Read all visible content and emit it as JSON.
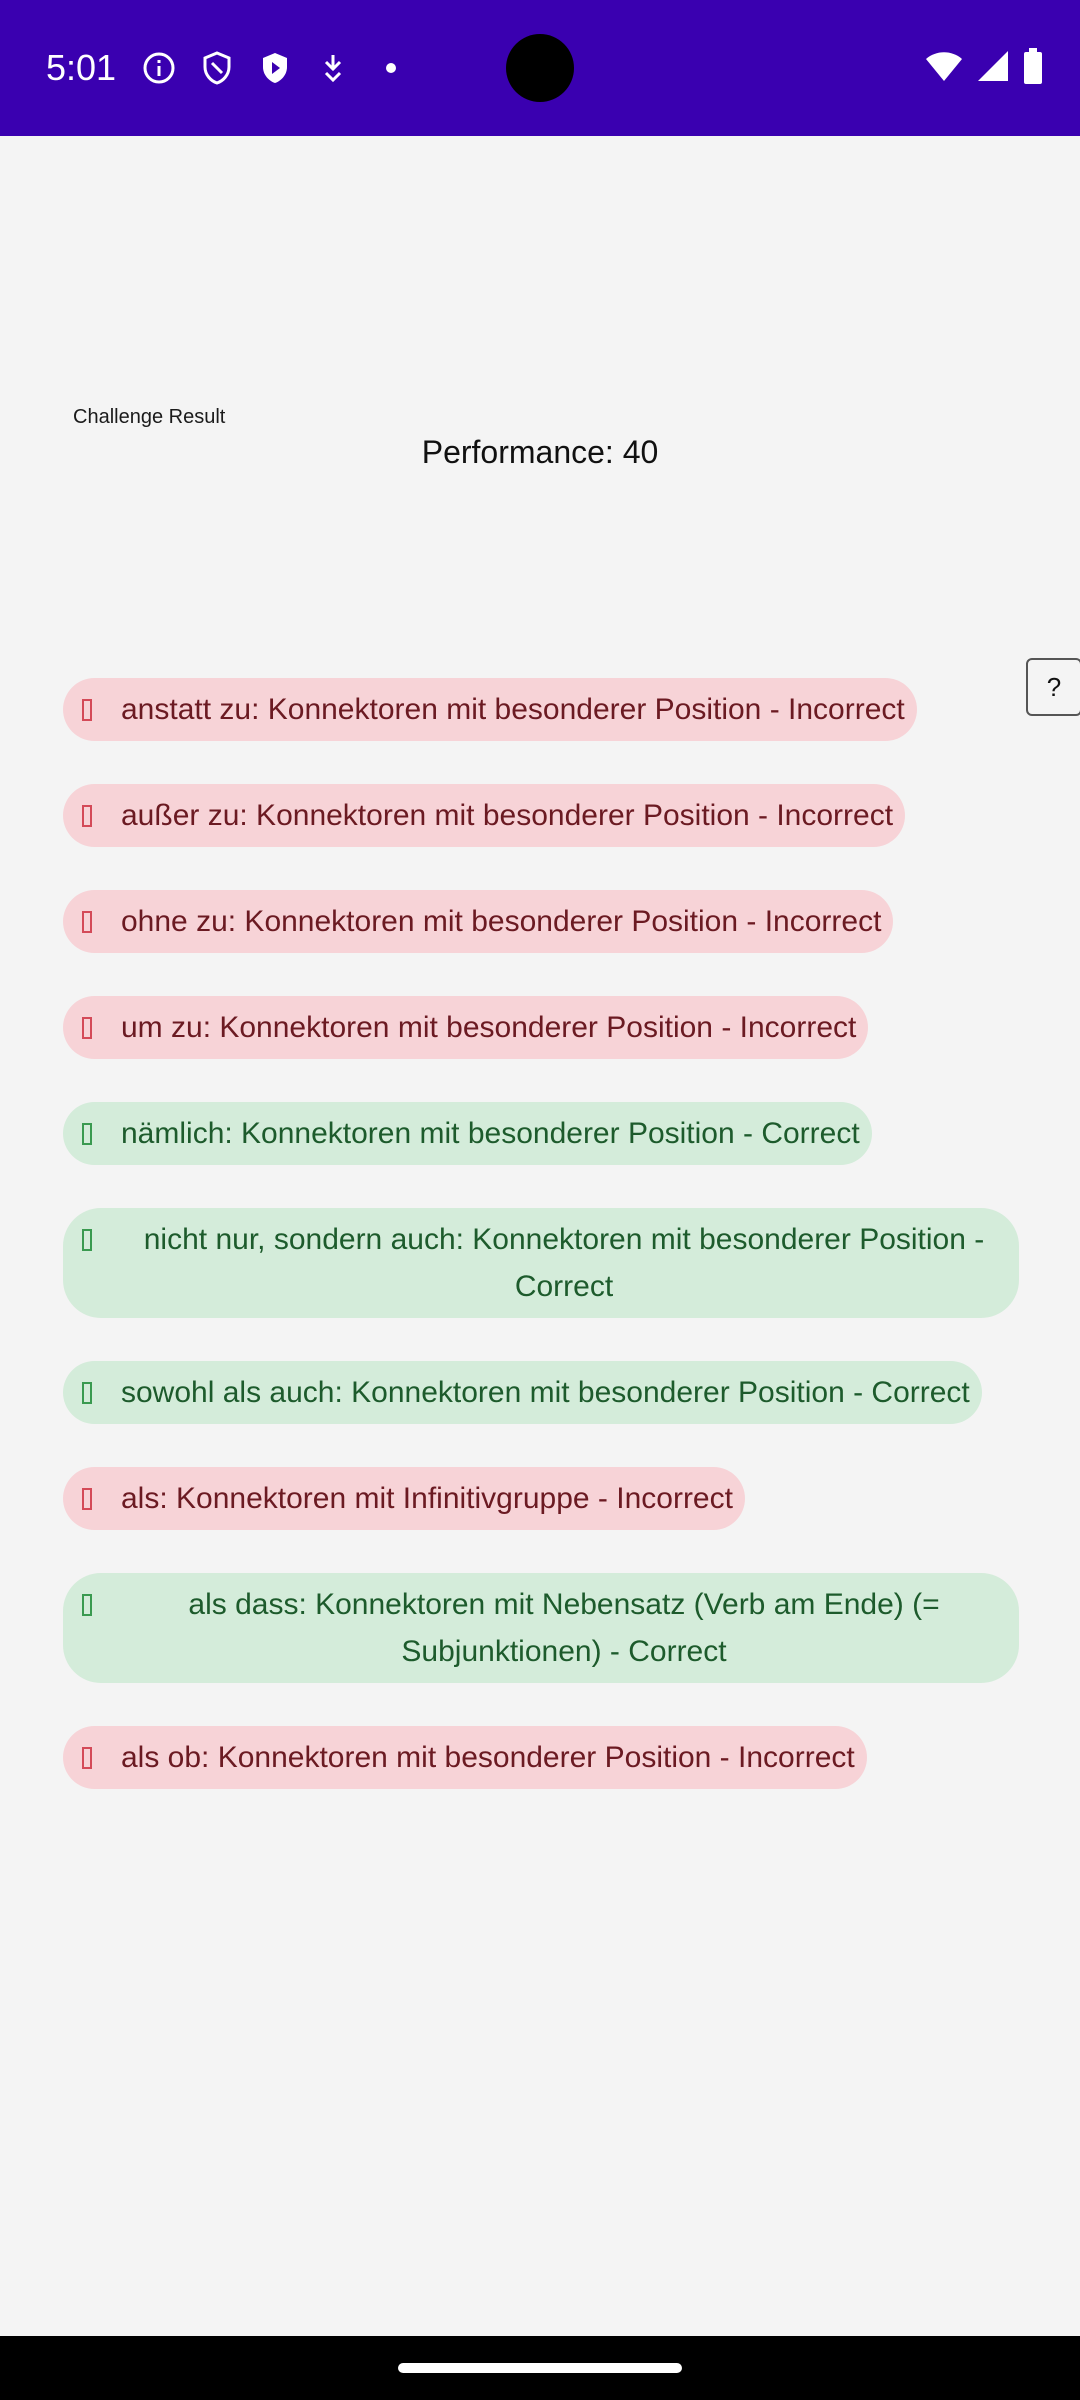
{
  "status_bar": {
    "time": "5:01",
    "background": "#3a00b0",
    "left_icons": [
      "info-circle-icon",
      "shield-outline-icon",
      "shield-play-icon",
      "download-arrow-icon",
      "dot-icon"
    ],
    "right_icons": [
      "wifi-icon",
      "cellular-signal-icon",
      "battery-icon"
    ]
  },
  "header": {
    "title": "Challenge Result",
    "performance": "Performance: 40"
  },
  "help_button": {
    "label": "?"
  },
  "results": [
    {
      "text": "anstatt zu: Konnektoren mit besonderer Position - Incorrect",
      "status": "incorrect"
    },
    {
      "text": "außer zu: Konnektoren mit besonderer Position - Incorrect",
      "status": "incorrect"
    },
    {
      "text": "ohne zu: Konnektoren mit besonderer Position - Incorrect",
      "status": "incorrect"
    },
    {
      "text": "um zu: Konnektoren mit besonderer Position - Incorrect",
      "status": "incorrect"
    },
    {
      "text": "nämlich: Konnektoren mit besonderer Position - Correct",
      "status": "correct"
    },
    {
      "text": "nicht nur, sondern auch: Konnektoren mit besonderer Position - Correct",
      "status": "correct"
    },
    {
      "text": "sowohl als auch: Konnektoren mit besonderer Position - Correct",
      "status": "correct"
    },
    {
      "text": "als: Konnektoren mit Infinitivgruppe - Incorrect",
      "status": "incorrect"
    },
    {
      "text": "als dass: Konnektoren mit Nebensatz (Verb am Ende) (= Subjunktionen) - Correct",
      "status": "correct"
    },
    {
      "text": "als ob: Konnektoren mit besonderer Position - Incorrect",
      "status": "incorrect"
    }
  ],
  "colors": {
    "incorrect_bg": "#f7d3d7",
    "incorrect_text": "#6b1a22",
    "correct_bg": "#d4ecda",
    "correct_text": "#1d5b2c",
    "page_bg": "#f4f4f4"
  }
}
